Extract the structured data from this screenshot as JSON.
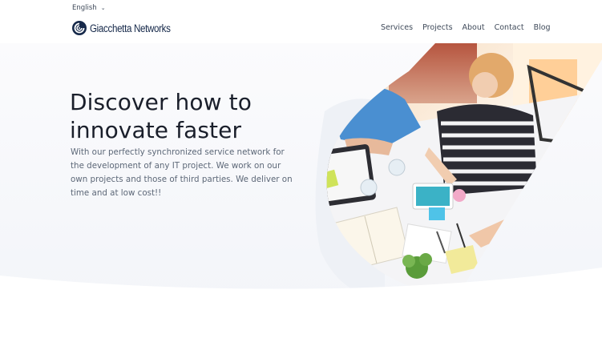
{
  "language": {
    "label": "English",
    "chevron_icon": "chevron-down-icon"
  },
  "brand": {
    "name": "Giacchetta Networks",
    "logo_icon": "spiral-logo-icon",
    "color": "#16294a"
  },
  "nav": {
    "items": [
      "Services",
      "Projects",
      "About",
      "Contact",
      "Blog"
    ]
  },
  "hero": {
    "title_line1": "Discover how to",
    "title_line2": "innovate faster",
    "description": "With our perfectly synchronized service network for the development of any IT project. We work on our own projects and those of third parties. We deliver on time and at low cost!!",
    "image_alt": "team meeting around a desk seen from above"
  },
  "colors": {
    "background": "#f3f5f9",
    "text": "#1a1f2b",
    "muted": "#5d6878"
  }
}
